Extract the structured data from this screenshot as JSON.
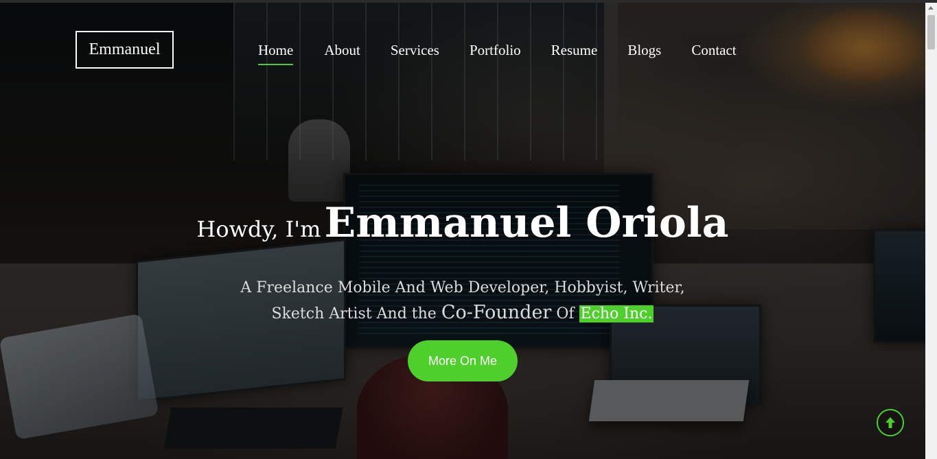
{
  "brand": {
    "logo_text": "Emmanuel"
  },
  "nav": {
    "items": [
      {
        "label": "Home",
        "active": true
      },
      {
        "label": "About"
      },
      {
        "label": "Services"
      },
      {
        "label": "Portfolio"
      },
      {
        "label": "Resume"
      },
      {
        "label": "Blogs"
      },
      {
        "label": "Contact"
      }
    ]
  },
  "hero": {
    "greeting": "Howdy, I'm",
    "name": "Emmanuel Oriola",
    "subtitle_line1": "A Freelance Mobile And Web Developer, Hobbyist, Writer,",
    "subtitle_line2_a": "Sketch Artist And the",
    "subtitle_line2_b": "Co-Founder",
    "subtitle_line2_c": "Of",
    "subtitle_highlight": "Echo Inc.",
    "cta_label": "More On Me"
  },
  "colors": {
    "accent": "#4fcf2c",
    "text": "#ffffff"
  },
  "icons": {
    "scroll_top": "arrow-up-icon"
  }
}
